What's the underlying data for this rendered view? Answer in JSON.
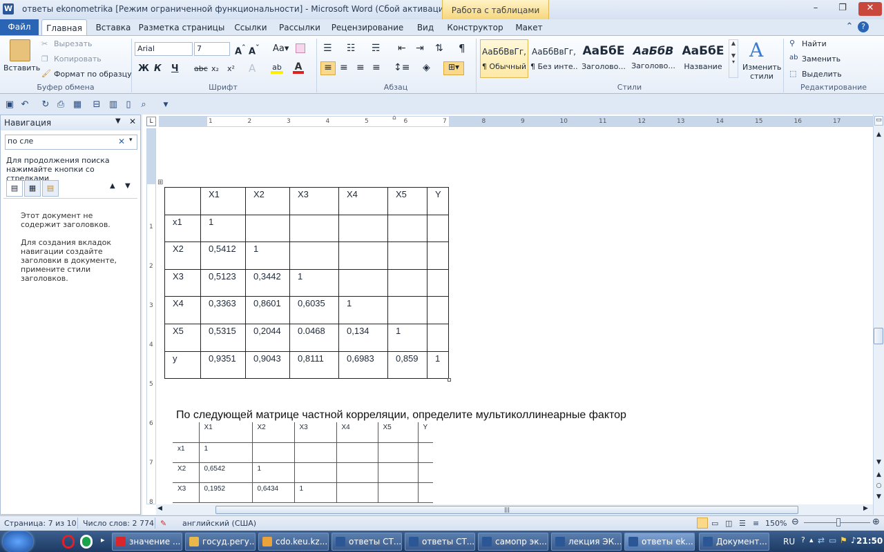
{
  "window": {
    "title": "ответы ekonometrika [Режим ограниченной функциональности]  -  Microsoft Word (Сбой активации проду...",
    "context_tab": "Работа с таблицами",
    "minimize": "–",
    "restore": "❐",
    "close": "✕"
  },
  "tabs": [
    {
      "label": "Файл"
    },
    {
      "label": "Главная"
    },
    {
      "label": "Вставка"
    },
    {
      "label": "Разметка страницы"
    },
    {
      "label": "Ссылки"
    },
    {
      "label": "Рассылки"
    },
    {
      "label": "Рецензирование"
    },
    {
      "label": "Вид"
    },
    {
      "label": "Конструктор"
    },
    {
      "label": "Макет"
    }
  ],
  "clipboard": {
    "group": "Буфер обмена",
    "paste": "Вставить",
    "cut": "Вырезать",
    "copy": "Копировать",
    "format_painter": "Формат по образцу"
  },
  "font": {
    "group": "Шрифт",
    "name": "Arial",
    "size": "7"
  },
  "paragraph": {
    "group": "Абзац"
  },
  "styles": {
    "group": "Стили",
    "items": [
      {
        "sample": "АаБбВвГг,",
        "name": "¶ Обычный"
      },
      {
        "sample": "АаБбВвГг,",
        "name": "¶ Без инте..."
      },
      {
        "sample": "АаБбЕ",
        "name": "Заголово..."
      },
      {
        "sample": "АаБбВ",
        "name": "Заголово..."
      },
      {
        "sample": "АаБбЕ",
        "name": "Название"
      }
    ],
    "change_styles": "Изменить стили"
  },
  "editing": {
    "group": "Редактирование",
    "find": "Найти",
    "replace": "Заменить",
    "select": "Выделить"
  },
  "nav": {
    "title": "Навигация",
    "search_value": "по сле",
    "hint": "Для продолжения поиска нажимайте кнопки со стрелками",
    "no_headings": "Этот документ не содержит заголовков.",
    "create_tabs": "Для создания вкладок навигации создайте заголовки в документе, примените стили заголовков."
  },
  "ruler": {
    "h_numbers": [
      "1",
      "2",
      "3",
      "4",
      "5",
      "6",
      "7",
      "8",
      "9",
      "10",
      "11",
      "12",
      "13",
      "14",
      "15",
      "16",
      "17"
    ],
    "v_numbers": [
      "1",
      "2",
      "3",
      "4",
      "5",
      "6",
      "7",
      "8"
    ]
  },
  "table1": [
    [
      "",
      "X1",
      "X2",
      "X3",
      "X4",
      "X5",
      "Y"
    ],
    [
      "x1",
      "1",
      "",
      "",
      "",
      "",
      ""
    ],
    [
      "X2",
      "0,5412",
      "1",
      "",
      "",
      "",
      ""
    ],
    [
      "X3",
      "0,5123",
      "0,3442",
      "1",
      "",
      "",
      ""
    ],
    [
      "X4",
      "0,3363",
      "0,8601",
      "0,6035",
      "1",
      "",
      ""
    ],
    [
      "X5",
      "0,5315",
      "0,2044",
      "0.0468",
      "0,134",
      "1",
      ""
    ],
    [
      "y",
      "0,9351",
      "0,9043",
      "0,8111",
      "0,6983",
      "0,859",
      "1"
    ]
  ],
  "paragraph_text": "По следующей матрице частной корреляции, определите мультиколлинеарные фактор",
  "table2": [
    [
      "",
      "X1",
      "X2",
      "X3",
      "X4",
      "X5",
      "Y"
    ],
    [
      "x1",
      "1",
      "",
      "",
      "",
      "",
      ""
    ],
    [
      "X2",
      "0,6542",
      "1",
      "",
      "",
      "",
      ""
    ],
    [
      "X3",
      "0,1952",
      "0,6434",
      "1",
      "",
      "",
      ""
    ]
  ],
  "status": {
    "page": "Страница: 7 из 10",
    "words": "Число слов: 2 774",
    "language": "английский (США)",
    "zoom": "150%"
  },
  "taskbar": {
    "items": [
      {
        "label": "значение ...",
        "color": "#d9262c"
      },
      {
        "label": "госуд.регу...",
        "color": "#e8b84a"
      },
      {
        "label": "cdo.keu.kz...",
        "color": "#e9a33a"
      },
      {
        "label": "ответы СТ...",
        "color": "#2b5797"
      },
      {
        "label": "ответы СТ...",
        "color": "#2b5797"
      },
      {
        "label": "самопр эк...",
        "color": "#2b5797"
      },
      {
        "label": "лекция ЭК...",
        "color": "#2b5797"
      },
      {
        "label": "ответы ek...",
        "color": "#2b5797"
      },
      {
        "label": "Документ...",
        "color": "#2b5797"
      }
    ],
    "lang": "RU",
    "time": "21:50"
  }
}
